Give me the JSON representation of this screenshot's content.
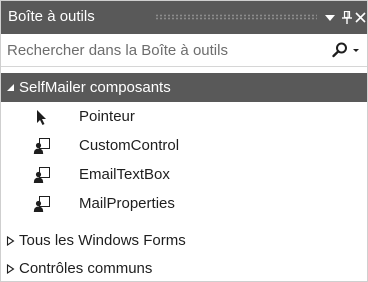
{
  "titlebar": {
    "title": "Boîte à outils"
  },
  "search": {
    "placeholder": "Rechercher dans la Boîte à outils"
  },
  "tree": {
    "categories": [
      {
        "label": "SelfMailer composants",
        "expanded": true,
        "selected": true,
        "items": [
          {
            "label": "Pointeur",
            "icon": "pointer-arrow-icon"
          },
          {
            "label": "CustomControl",
            "icon": "user-control-icon"
          },
          {
            "label": "EmailTextBox",
            "icon": "user-control-icon"
          },
          {
            "label": "MailProperties",
            "icon": "user-control-icon"
          }
        ]
      },
      {
        "label": "Tous les Windows Forms",
        "expanded": false,
        "selected": false
      },
      {
        "label": "Contrôles communs",
        "expanded": false,
        "selected": false
      }
    ]
  },
  "colors": {
    "titlebar_bg": "#595959",
    "selected_bg": "#595959",
    "text": "#1e1e1e",
    "placeholder": "#6d6d6d"
  }
}
